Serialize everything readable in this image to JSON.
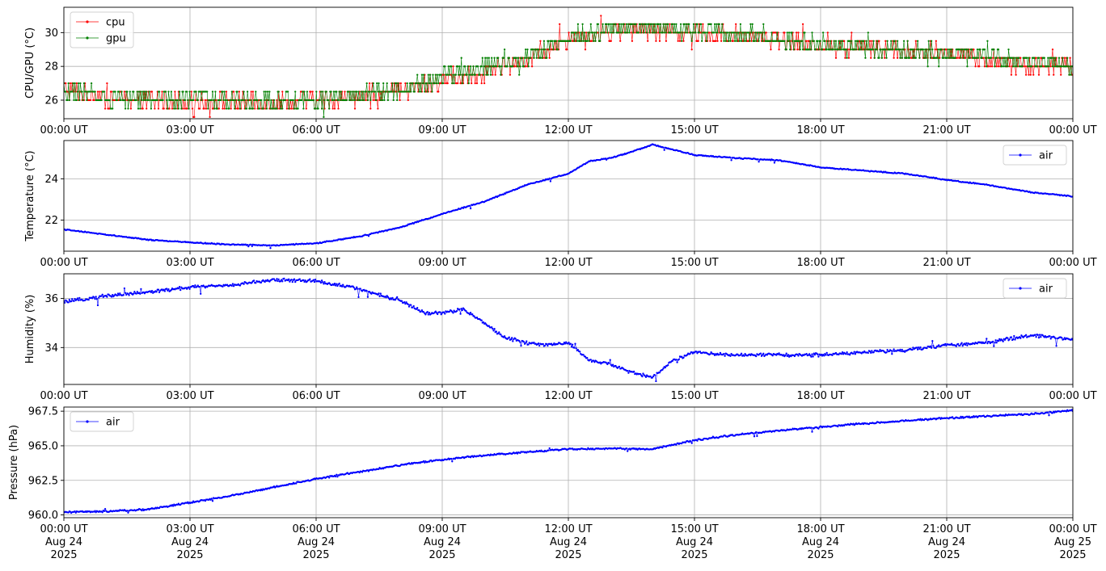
{
  "colors": {
    "cpu": "#ff0000",
    "gpu": "#008000",
    "air": "#0000ff",
    "grid": "#b0b0b0"
  },
  "x_tick_labels": [
    "00:00 UT",
    "03:00 UT",
    "06:00 UT",
    "09:00 UT",
    "12:00 UT",
    "15:00 UT",
    "18:00 UT",
    "21:00 UT",
    "00:00 UT"
  ],
  "x_tick_date_lines": [
    [
      "Aug 24",
      "2025"
    ],
    [
      "Aug 24",
      "2025"
    ],
    [
      "Aug 24",
      "2025"
    ],
    [
      "Aug 24",
      "2025"
    ],
    [
      "Aug 24",
      "2025"
    ],
    [
      "Aug 24",
      "2025"
    ],
    [
      "Aug 24",
      "2025"
    ],
    [
      "Aug 24",
      "2025"
    ],
    [
      "Aug 25",
      "2025"
    ]
  ],
  "chart_data": [
    {
      "type": "line",
      "ylabel": "CPU/GPU (°C)",
      "xlim": [
        "2025-08-24 00:00",
        "2025-08-25 00:00"
      ],
      "ylim": [
        24.9,
        31.5
      ],
      "yticks": [
        26,
        28,
        30
      ],
      "ytick_labels": [
        "26",
        "28",
        "30"
      ],
      "grid": true,
      "legend": "upper-left",
      "quantized": true,
      "noise": 0.7,
      "x_hours": [
        0,
        1,
        2,
        3,
        4,
        5,
        6,
        7,
        8,
        9,
        10,
        11,
        12,
        13,
        14,
        15,
        16,
        17,
        18,
        19,
        20,
        21,
        22,
        23,
        24
      ],
      "series": [
        {
          "name": "cpu",
          "color": "#ff0000",
          "values": [
            26.6,
            26.1,
            26.0,
            26.0,
            25.9,
            25.9,
            26.0,
            26.2,
            26.5,
            27.2,
            27.7,
            28.4,
            29.6,
            30.1,
            30.2,
            30.0,
            29.8,
            29.6,
            29.2,
            29.1,
            28.9,
            28.8,
            28.4,
            28.0,
            28.0
          ]
        },
        {
          "name": "gpu",
          "color": "#008000",
          "values": [
            26.5,
            26.2,
            26.1,
            26.1,
            26.0,
            25.9,
            26.1,
            26.3,
            26.6,
            27.4,
            27.9,
            28.5,
            29.7,
            30.2,
            30.3,
            30.1,
            29.9,
            29.7,
            29.2,
            29.1,
            28.9,
            28.8,
            28.5,
            28.2,
            28.1
          ]
        }
      ]
    },
    {
      "type": "line",
      "ylabel": "Temperature (°C)",
      "xlim": [
        "2025-08-24 00:00",
        "2025-08-25 00:00"
      ],
      "ylim": [
        20.5,
        25.85
      ],
      "yticks": [
        22,
        24
      ],
      "ytick_labels": [
        "22",
        "24"
      ],
      "grid": true,
      "legend": "upper-right",
      "quantized": false,
      "noise": 0.03,
      "x_hours": [
        0,
        1,
        2,
        3,
        4,
        5,
        6,
        7,
        8,
        9,
        10,
        11,
        12,
        12.5,
        13,
        13.5,
        14,
        15,
        16,
        17,
        18,
        19,
        20,
        21,
        22,
        23,
        24
      ],
      "series": [
        {
          "name": "air",
          "color": "#0000ff",
          "values": [
            21.55,
            21.3,
            21.05,
            20.92,
            20.82,
            20.78,
            20.88,
            21.2,
            21.65,
            22.3,
            22.9,
            23.7,
            24.25,
            24.85,
            25.0,
            25.3,
            25.65,
            25.15,
            25.0,
            24.9,
            24.55,
            24.4,
            24.25,
            23.95,
            23.7,
            23.35,
            23.15
          ]
        }
      ]
    },
    {
      "type": "line",
      "ylabel": "Humidity (%)",
      "xlim": [
        "2025-08-24 00:00",
        "2025-08-25 00:00"
      ],
      "ylim": [
        32.5,
        37.0
      ],
      "yticks": [
        34,
        36
      ],
      "ytick_labels": [
        "34",
        "36"
      ],
      "grid": true,
      "legend": "upper-right",
      "quantized": false,
      "noise": 0.08,
      "x_hours": [
        0,
        1,
        2,
        3,
        4,
        5,
        6,
        7,
        8,
        8.6,
        9,
        9.5,
        10,
        10.5,
        11,
        11.5,
        12,
        12.5,
        13,
        13.5,
        14,
        14.5,
        15,
        16,
        17,
        18,
        19,
        20,
        21,
        22,
        23,
        24
      ],
      "series": [
        {
          "name": "air",
          "color": "#0000ff",
          "values": [
            35.85,
            36.1,
            36.25,
            36.45,
            36.55,
            36.75,
            36.7,
            36.4,
            35.9,
            35.4,
            35.4,
            35.55,
            35.0,
            34.4,
            34.2,
            34.1,
            34.2,
            33.5,
            33.3,
            33.0,
            32.8,
            33.5,
            33.8,
            33.7,
            33.7,
            33.7,
            33.8,
            33.9,
            34.1,
            34.2,
            34.5,
            34.35
          ]
        }
      ]
    },
    {
      "type": "line",
      "ylabel": "Pressure (hPa)",
      "xlim": [
        "2025-08-24 00:00",
        "2025-08-25 00:00"
      ],
      "ylim": [
        959.8,
        967.8
      ],
      "yticks": [
        960.0,
        962.5,
        965.0,
        967.5
      ],
      "ytick_labels": [
        "960.0",
        "962.5",
        "965.0",
        "967.5"
      ],
      "grid": true,
      "legend": "upper-left",
      "quantized": false,
      "noise": 0.07,
      "x_hours": [
        0,
        1,
        2,
        3,
        4,
        5,
        6,
        7,
        8,
        9,
        10,
        11,
        12,
        13,
        14,
        15,
        16,
        17,
        18,
        19,
        20,
        21,
        22,
        23,
        24
      ],
      "series": [
        {
          "name": "air",
          "color": "#0000ff",
          "values": [
            960.2,
            960.25,
            960.4,
            960.9,
            961.4,
            962.0,
            962.6,
            963.1,
            963.6,
            964.0,
            964.3,
            964.55,
            964.75,
            964.8,
            964.75,
            965.4,
            965.8,
            966.1,
            966.35,
            966.6,
            966.8,
            967.0,
            967.15,
            967.3,
            967.55
          ]
        }
      ]
    }
  ]
}
